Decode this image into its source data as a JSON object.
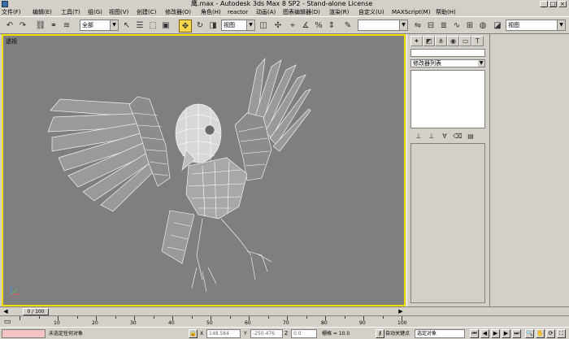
{
  "window": {
    "title": "鹰.max - Autodesk 3ds Max 8 SP2  - Stand-alone License",
    "minimize": "_",
    "maximize": "□",
    "close": "×"
  },
  "menu": [
    "文件(F)",
    "编辑(E)",
    "工具(T)",
    "组(G)",
    "视图(V)",
    "创建(C)",
    "修改器(O)",
    "角色(H)",
    "reactor",
    "动画(A)",
    "图表编辑器(D)",
    "渲染(R)",
    "自定义(U)",
    "MAXScript(M)",
    "帮助(H)"
  ],
  "toolbar": {
    "selection_filter": "全部",
    "reference_coord": "视图",
    "named_selection": "",
    "right_view": "视图"
  },
  "viewport": {
    "label": "透视",
    "border_color": "#f0e000"
  },
  "command_panel": {
    "tab_icons": [
      "create-icon",
      "modify-icon",
      "hierarchy-icon",
      "motion-icon",
      "display-icon",
      "utilities-icon"
    ],
    "modifier_list": "修改器列表"
  },
  "time_slider": {
    "frame_label": "0 / 100",
    "current_frame": 0,
    "total_frames": 100
  },
  "trackbar": {
    "ticks": [
      "10",
      "20",
      "30",
      "40",
      "50",
      "60",
      "70",
      "80",
      "90",
      "100"
    ]
  },
  "status": {
    "selection": "未选定任何对象",
    "x_label": "X",
    "x_value": "148.584",
    "y_label": "Y",
    "y_value": "-250.476",
    "z_label": "Z",
    "z_value": "0.0",
    "grid": "栅格 = 10.0",
    "auto_key": "自动关键点",
    "set_key_mode": "选定对象"
  }
}
